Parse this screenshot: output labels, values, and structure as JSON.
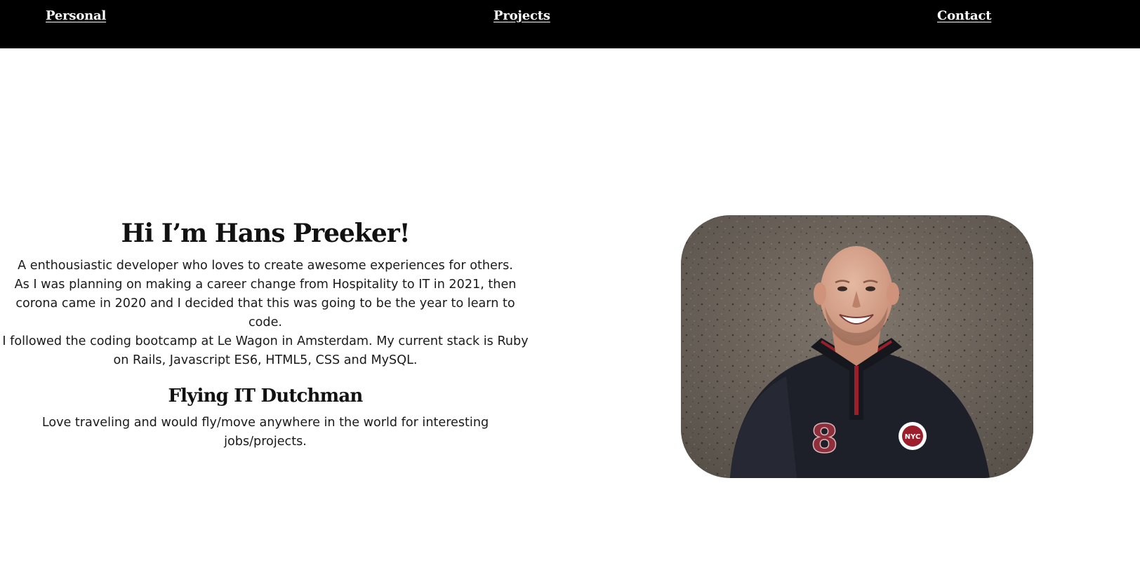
{
  "nav": {
    "personal": "Personal",
    "projects": "Projects",
    "contact": "Contact"
  },
  "intro": {
    "heading": "Hi I’m Hans Preeker!",
    "bio_lines": [
      "A enthousiastic developer who loves to create awesome experiences for others.",
      "As I was planning on making a career change from Hospitality to IT in 2021, then corona came in 2020 and I decided that this was going to be the year to learn to code.",
      "I followed the coding bootcamp at Le Wagon in Amsterdam. My current stack is Ruby on Rails, Javascript ES6, HTML5, CSS and MySQL."
    ],
    "subheading": "Flying IT Dutchman",
    "travel_text": "Love traveling and would fly/move anywhere in the world for interesting jobs/projects."
  },
  "portrait": {
    "shirt_number": "8",
    "badge_text": "NYC"
  },
  "colors": {
    "nav_background": "#000000",
    "nav_text": "#ffffff",
    "body_text": "#111111",
    "page_background": "#ffffff"
  }
}
